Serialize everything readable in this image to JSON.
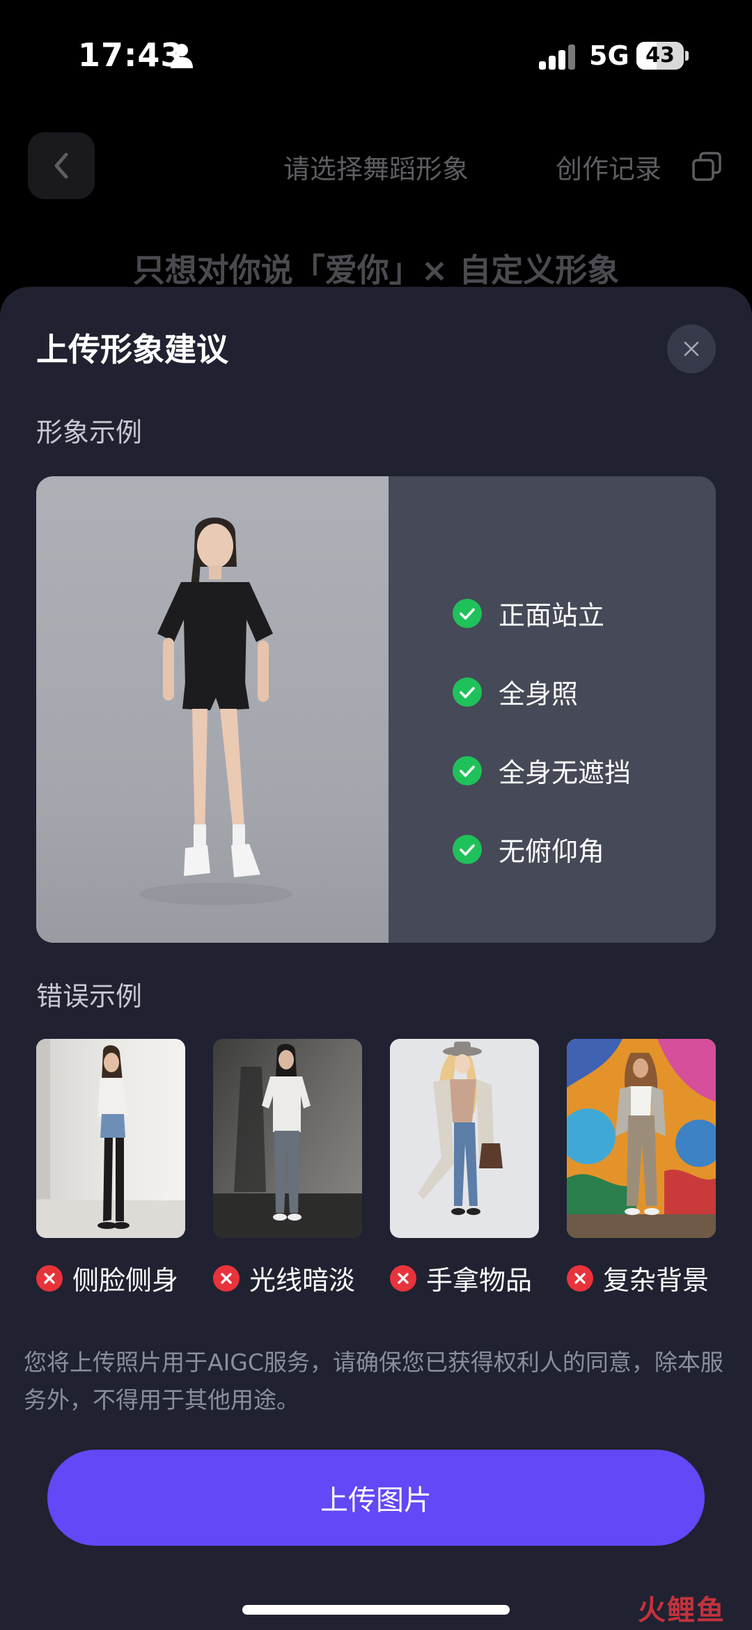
{
  "status_bar": {
    "time": "17:43",
    "network": "5G",
    "battery": "43",
    "battery_level": 0.43,
    "icons": [
      "person-icon",
      "signal-icon",
      "battery-icon"
    ]
  },
  "background_page": {
    "title": "请选择舞蹈形象",
    "records_label": "创作记录",
    "subtitle": "只想对你说「爱你」× 自定义形象",
    "icons": [
      "back-chevron-icon",
      "copy-icon"
    ]
  },
  "sheet": {
    "title": "上传形象建议",
    "close_icon": "close-icon",
    "correct_section_label": "形象示例",
    "correct_checklist": [
      {
        "label": "正面站立"
      },
      {
        "label": "全身照"
      },
      {
        "label": "全身无遮挡"
      },
      {
        "label": "无俯仰角"
      }
    ],
    "wrong_section_label": "错误示例",
    "wrong_examples": [
      {
        "label": "侧脸侧身"
      },
      {
        "label": "光线暗淡"
      },
      {
        "label": "手拿物品"
      },
      {
        "label": "复杂背景"
      }
    ],
    "consent_text": "您将上传照片用于AIGC服务，请确保您已获得权利人的同意，除本服务外，不得用于其他用途。",
    "upload_button_label": "上传图片"
  },
  "colors": {
    "sheet_bg": "#202231",
    "card_bg": "#464957",
    "accent": "#6248f6",
    "check_green": "#1fc25a",
    "error_red": "#e8333b"
  },
  "watermark": "火鲤鱼"
}
